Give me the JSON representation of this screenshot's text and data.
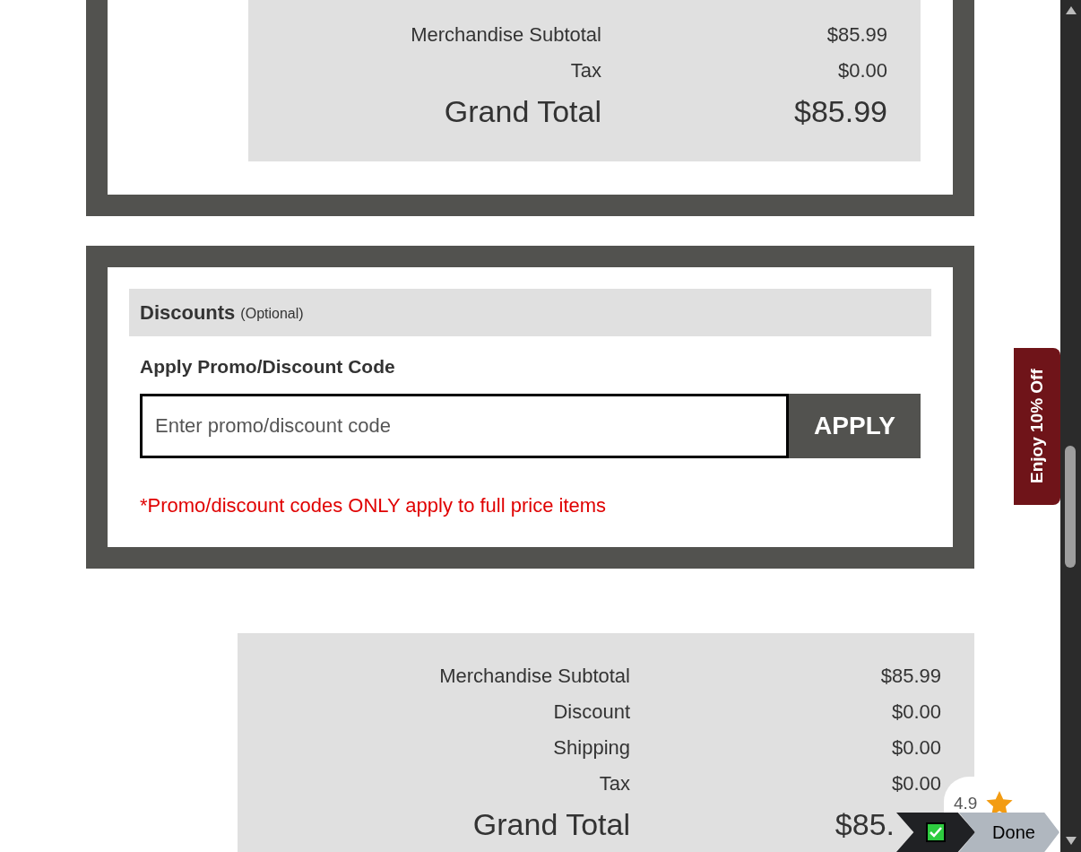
{
  "order_summary_top": {
    "rows": [
      {
        "kind": "line",
        "label": "Merchandise Subtotal",
        "value": "$85.99"
      },
      {
        "kind": "line",
        "label": "Tax",
        "value": "$0.00"
      },
      {
        "kind": "total",
        "label": "Grand Total",
        "value": "$85.99"
      }
    ]
  },
  "discounts": {
    "title": "Discounts",
    "note": "(Optional)",
    "promo_label": "Apply Promo/Discount Code",
    "promo_field": {
      "placeholder": "Enter promo/discount code"
    },
    "apply_button": "APPLY",
    "warning": "*Promo/discount codes ONLY apply to full price items"
  },
  "order_summary_bottom": {
    "rows": [
      {
        "kind": "line",
        "label": "Merchandise Subtotal",
        "value": "$85.99"
      },
      {
        "kind": "line",
        "label": "Discount",
        "value": "$0.00"
      },
      {
        "kind": "line",
        "label": "Shipping",
        "value": "$0.00"
      },
      {
        "kind": "line",
        "label": "Tax",
        "value": "$0.00"
      },
      {
        "kind": "total",
        "label": "Grand Total",
        "value": "$85."
      }
    ]
  },
  "promo_tab": "Enjoy 10% Off",
  "rating_badge": {
    "score": "4.9"
  },
  "done_bar": {
    "checked": true,
    "label": "Done"
  }
}
